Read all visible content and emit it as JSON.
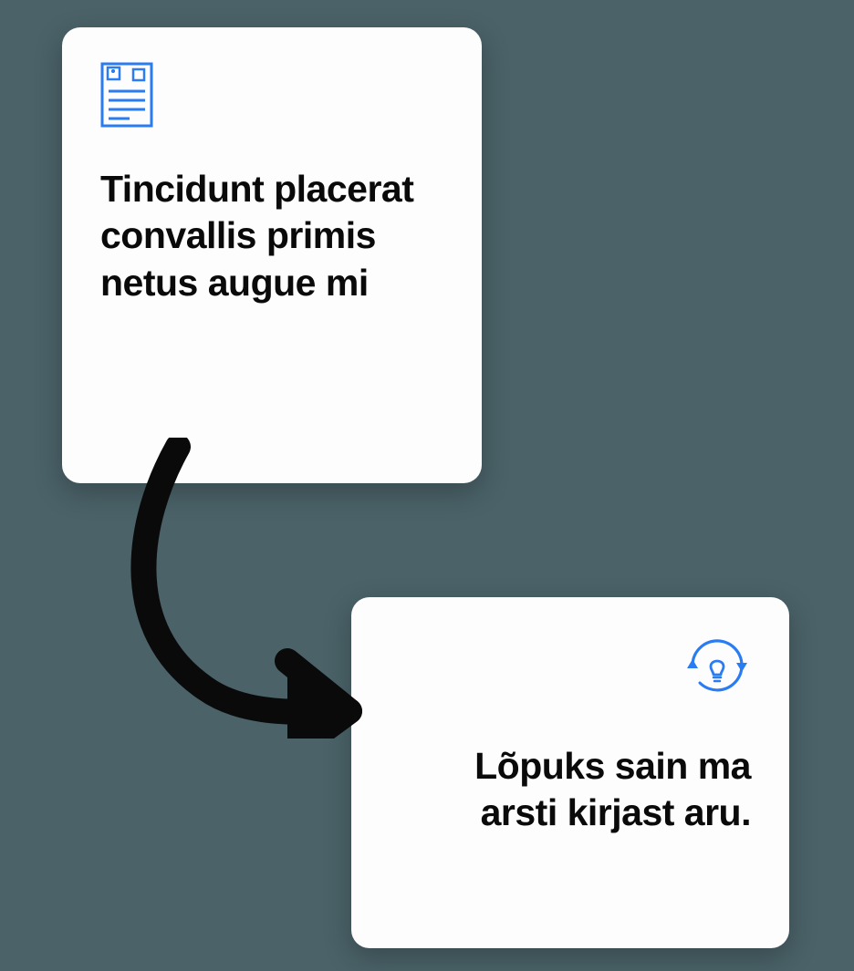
{
  "card1": {
    "title": "Tincidunt placerat convallis primis netus augue mi",
    "icon_name": "medical-document-icon"
  },
  "card2": {
    "title": "Lõpuks sain ma arsti kirjast aru.",
    "icon_name": "refresh-idea-icon"
  },
  "colors": {
    "accent": "#2a7cf2"
  }
}
